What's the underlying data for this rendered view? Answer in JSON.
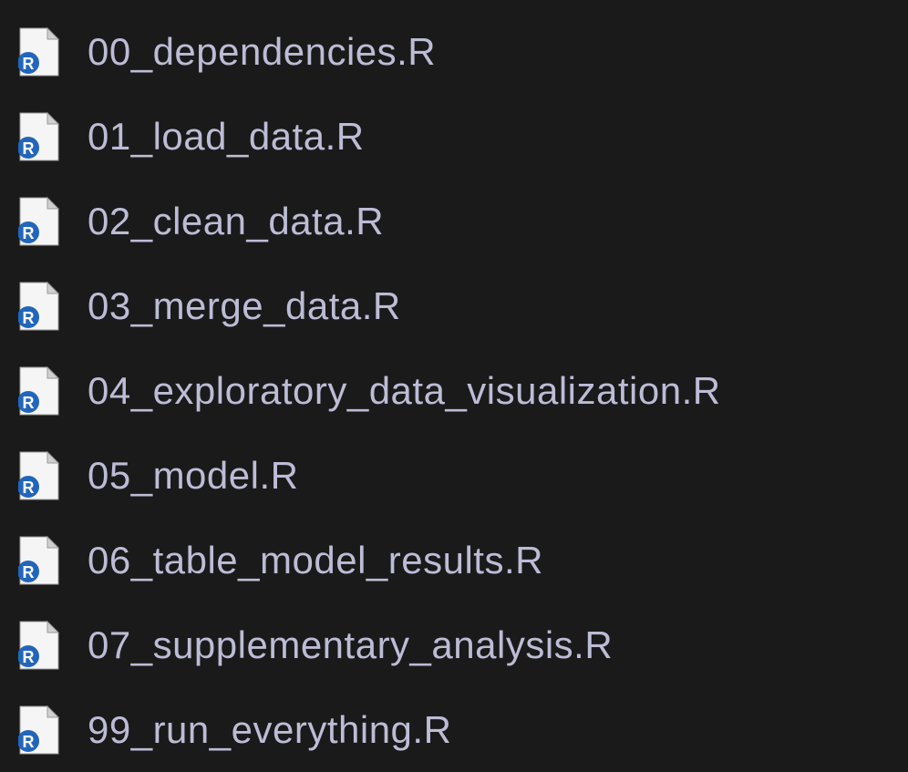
{
  "files": [
    {
      "name": "00_dependencies.R"
    },
    {
      "name": "01_load_data.R"
    },
    {
      "name": "02_clean_data.R"
    },
    {
      "name": "03_merge_data.R"
    },
    {
      "name": "04_exploratory_data_visualization.R"
    },
    {
      "name": "05_model.R"
    },
    {
      "name": "06_table_model_results.R"
    },
    {
      "name": "07_supplementary_analysis.R"
    },
    {
      "name": "99_run_everything.R"
    }
  ],
  "icon_label": "R"
}
